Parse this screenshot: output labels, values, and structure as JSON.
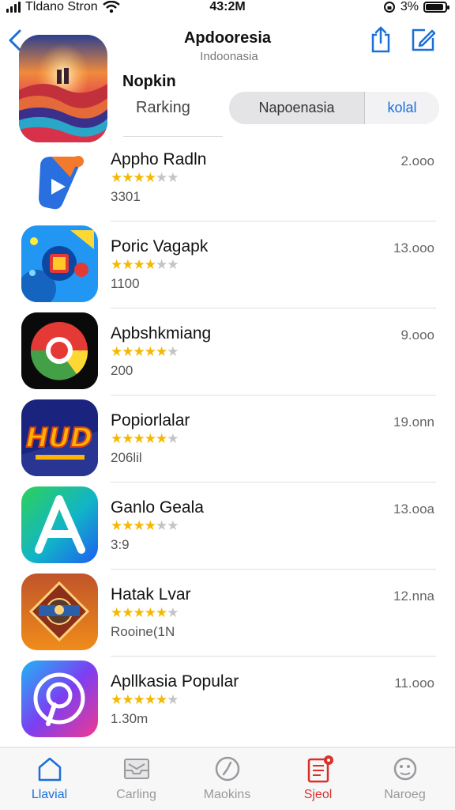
{
  "status_bar": {
    "carrier": "Tldano Stron",
    "time": "43:2M",
    "battery": "3%"
  },
  "header": {
    "title": "Apdooresia",
    "subtitle": "Indoonasia",
    "section_title": "Nopkin",
    "ranking_label": "Rarking"
  },
  "segment": {
    "options": [
      "Napoenasia",
      "kolal"
    ],
    "selected": "Napoenasia"
  },
  "apps": [
    {
      "name": "Appho Radln",
      "rating": 3.5,
      "count": "3301",
      "size": "2.ooo"
    },
    {
      "name": "Poric Vagapk",
      "rating": 4,
      "count": "1100",
      "size": "13.ooo"
    },
    {
      "name": "Apbshkmiang",
      "rating": 4.5,
      "count": "200",
      "size": "9.ooo"
    },
    {
      "name": "Popiorlalar",
      "rating": 4.5,
      "count": "206lil",
      "size": "19.onn"
    },
    {
      "name": "Ganlo Geala",
      "rating": 3.5,
      "count": "3:9",
      "size": "13.ooa"
    },
    {
      "name": "Hatak Lvar",
      "rating": 4.5,
      "count": "Rooine(1N",
      "size": "12.nna"
    },
    {
      "name": "Apllkasia Popular",
      "rating": 4.5,
      "count": "1.30m",
      "size": "11.ooo"
    }
  ],
  "tabs": [
    {
      "label": "Llavial",
      "icon": "home-icon",
      "state": "active"
    },
    {
      "label": "Carling",
      "icon": "tray-icon",
      "state": "normal"
    },
    {
      "label": "Maokins",
      "icon": "compass-icon",
      "state": "normal"
    },
    {
      "label": "Sjeol",
      "icon": "document-badge-icon",
      "state": "alert"
    },
    {
      "label": "Naroeg",
      "icon": "search-face-icon",
      "state": "normal"
    }
  ],
  "colors": {
    "accent": "#1a6fd8",
    "star": "#f5b800",
    "alert": "#d9302a"
  }
}
